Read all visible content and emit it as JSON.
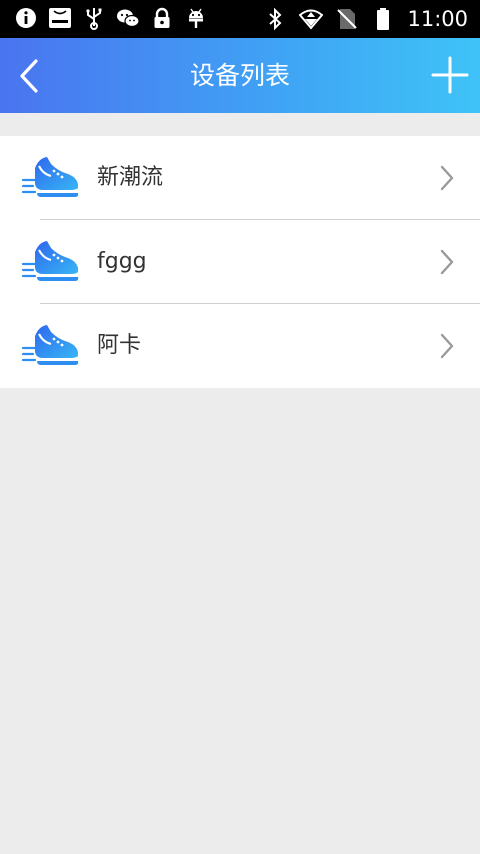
{
  "status_bar": {
    "time": "11:00",
    "left_icons": [
      "info-icon",
      "coolpad-icon",
      "usb-icon",
      "wechat-icon",
      "lock-icon",
      "android-icon"
    ],
    "right_icons": [
      "bluetooth-icon",
      "wifi-icon",
      "no-sim-icon",
      "battery-icon"
    ]
  },
  "header": {
    "title": "设备列表"
  },
  "devices": [
    {
      "name": "新潮流"
    },
    {
      "name": "fggg"
    },
    {
      "name": "阿卡"
    }
  ],
  "colors": {
    "header_start": "#4a74f0",
    "header_end": "#3fc3f7",
    "background": "#ececec",
    "icon_blue": "#2d7bf0"
  }
}
